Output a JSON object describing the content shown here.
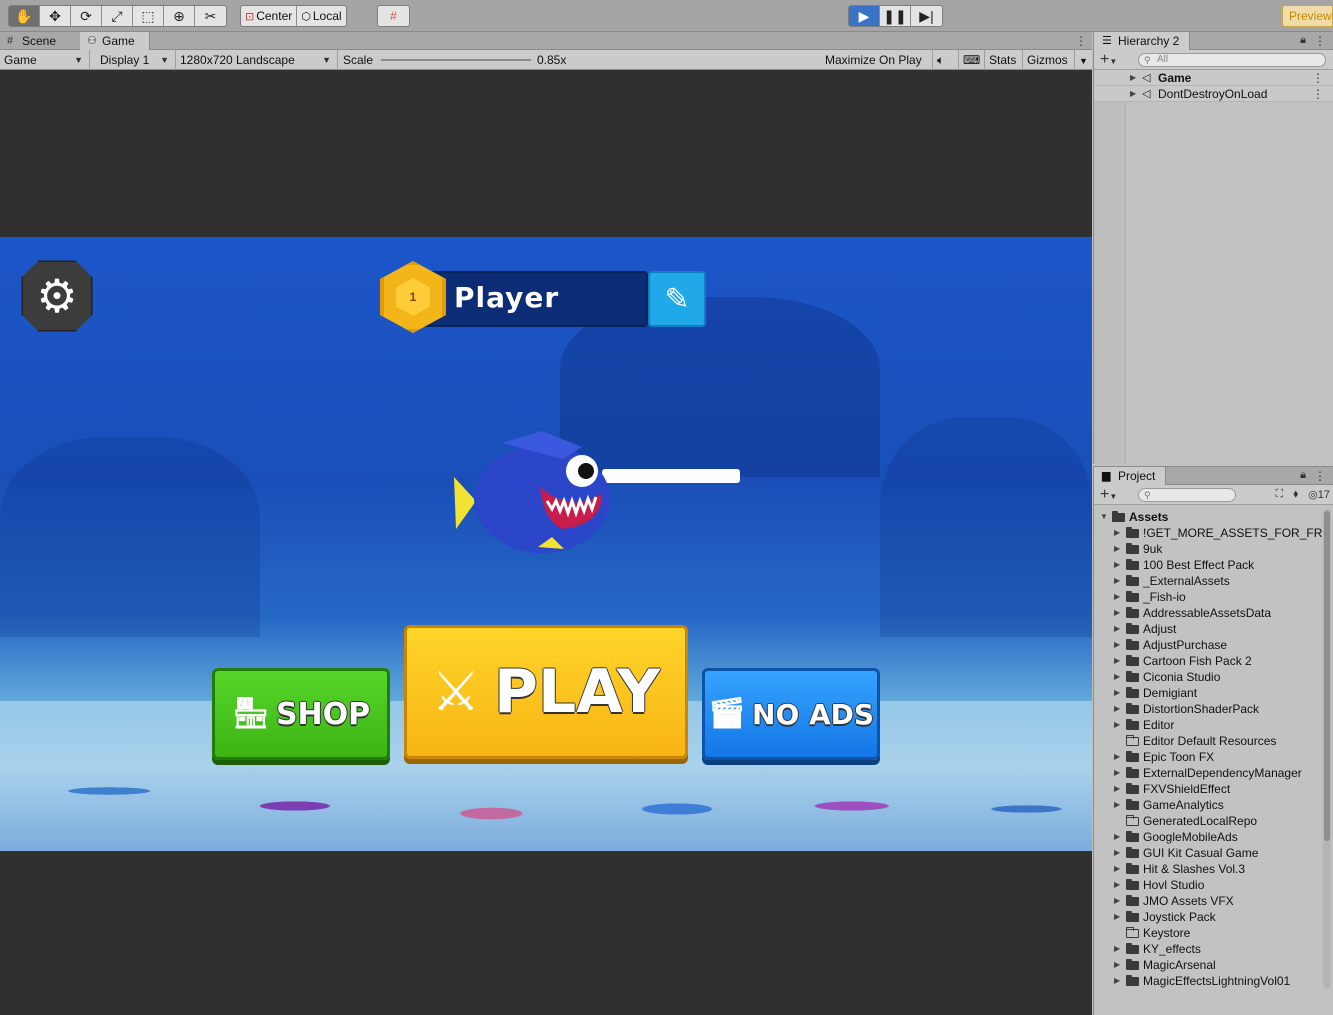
{
  "toolbar": {
    "tools": [
      "hand-icon",
      "move-icon",
      "rotate-icon",
      "scale-icon",
      "rect-icon",
      "transform-icon",
      "custom-tool-icon"
    ],
    "pivot_label": "Center",
    "space_label": "Local",
    "preview_label": "Preview"
  },
  "game_panel": {
    "tabs": [
      {
        "label": "Scene"
      },
      {
        "label": "Game"
      }
    ],
    "view_mode": "Game",
    "display": "Display 1",
    "resolution": "1280x720 Landscape",
    "scale_label": "Scale",
    "scale_value": "0.85x",
    "maximize_label": "Maximize On Play",
    "stats_label": "Stats",
    "gizmos_label": "Gizmos"
  },
  "game": {
    "player_name": "Player",
    "level": "1",
    "shop_label": "SHOP",
    "play_label": "PLAY",
    "noads_label": "NO ADS"
  },
  "hierarchy": {
    "title": "Hierarchy 2",
    "search_placeholder": "All",
    "items": [
      {
        "label": "Game",
        "bold": true
      },
      {
        "label": "DontDestroyOnLoad",
        "bold": false
      }
    ]
  },
  "project": {
    "title": "Project",
    "hidden_count": "17",
    "root": "Assets",
    "folders": [
      {
        "label": "!GET_MORE_ASSETS_FOR_FRE",
        "expandable": true
      },
      {
        "label": "9uk",
        "expandable": true
      },
      {
        "label": "100 Best Effect Pack",
        "expandable": true
      },
      {
        "label": "_ExternalAssets",
        "expandable": true
      },
      {
        "label": "_Fish-io",
        "expandable": true
      },
      {
        "label": "AddressableAssetsData",
        "expandable": true
      },
      {
        "label": "Adjust",
        "expandable": true
      },
      {
        "label": "AdjustPurchase",
        "expandable": true
      },
      {
        "label": "Cartoon Fish Pack 2",
        "expandable": true
      },
      {
        "label": "Ciconia Studio",
        "expandable": true
      },
      {
        "label": "Demigiant",
        "expandable": true
      },
      {
        "label": "DistortionShaderPack",
        "expandable": true
      },
      {
        "label": "Editor",
        "expandable": true
      },
      {
        "label": "Editor Default Resources",
        "expandable": false
      },
      {
        "label": "Epic Toon FX",
        "expandable": true
      },
      {
        "label": "ExternalDependencyManager",
        "expandable": true
      },
      {
        "label": "FXVShieldEffect",
        "expandable": true
      },
      {
        "label": "GameAnalytics",
        "expandable": true
      },
      {
        "label": "GeneratedLocalRepo",
        "expandable": false
      },
      {
        "label": "GoogleMobileAds",
        "expandable": true
      },
      {
        "label": "GUI Kit Casual Game",
        "expandable": true
      },
      {
        "label": "Hit & Slashes Vol.3",
        "expandable": true
      },
      {
        "label": "Hovl Studio",
        "expandable": true
      },
      {
        "label": "JMO Assets VFX",
        "expandable": true
      },
      {
        "label": "Joystick Pack",
        "expandable": true
      },
      {
        "label": "Keystore",
        "expandable": false
      },
      {
        "label": "KY_effects",
        "expandable": true
      },
      {
        "label": "MagicArsenal",
        "expandable": true
      },
      {
        "label": "MagicEffectsLightningVol01",
        "expandable": true
      }
    ]
  }
}
